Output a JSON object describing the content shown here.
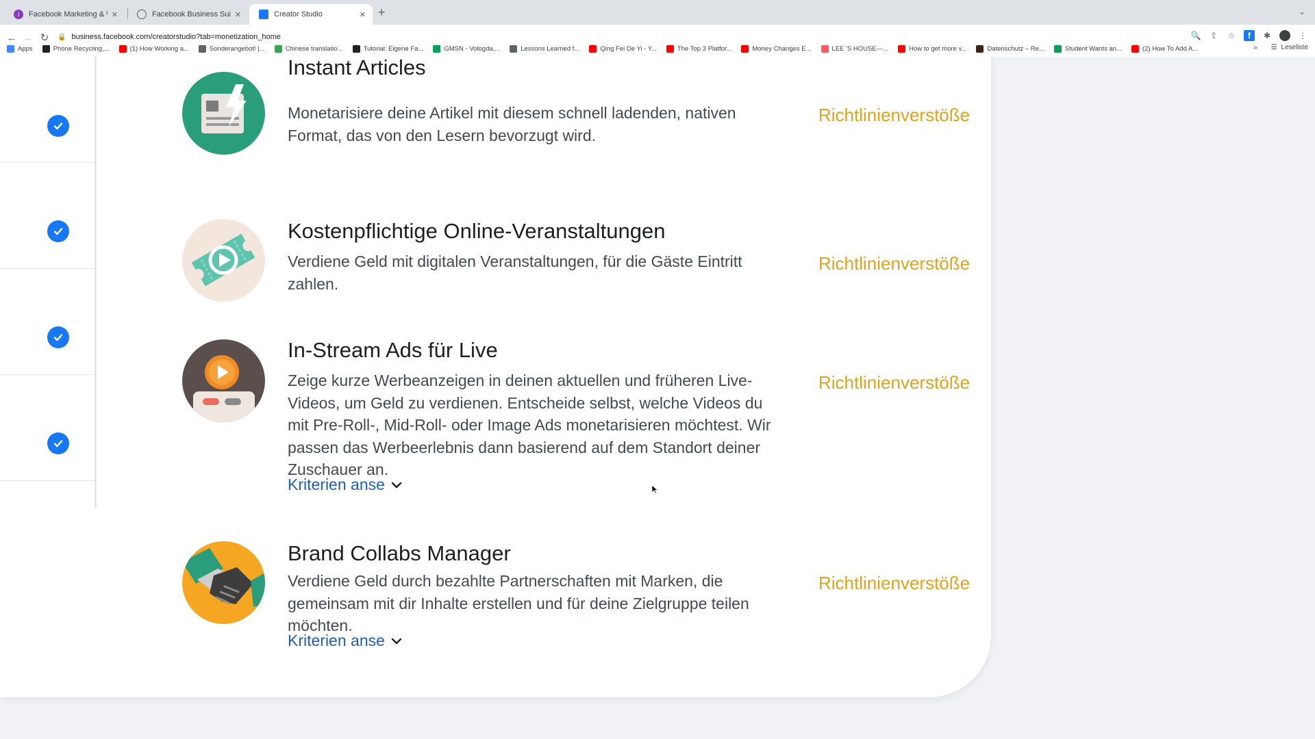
{
  "browser": {
    "tabs": [
      {
        "title": "Facebook Marketing & Werbea",
        "icon": "facebook-marketing-icon",
        "active": false
      },
      {
        "title": "Facebook Business Suite",
        "icon": "business-suite-icon",
        "active": false
      },
      {
        "title": "Creator Studio",
        "icon": "creator-studio-icon",
        "active": true
      }
    ],
    "url": "business.facebook.com/creatorstudio?tab=monetization_home",
    "bookmarks": [
      {
        "label": "Apps",
        "color": "#4285f4"
      },
      {
        "label": "Phone Recycling,...",
        "color": "#202124"
      },
      {
        "label": "(1) How Working a...",
        "color": "#ff0000"
      },
      {
        "label": "Sonderangebot! |...",
        "color": "#5f6368"
      },
      {
        "label": "Chinese translatio...",
        "color": "#34a853"
      },
      {
        "label": "Tutorial: Eigene Fa...",
        "color": "#202124"
      },
      {
        "label": "GMSN - Vologda,...",
        "color": "#0f9d58"
      },
      {
        "label": "Lessons Learned f...",
        "color": "#5f6368"
      },
      {
        "label": "Qing Fei De Yi - Y...",
        "color": "#ff0000"
      },
      {
        "label": "The Top 3 Platfor...",
        "color": "#ff0000"
      },
      {
        "label": "Money Changes E...",
        "color": "#ff0000"
      },
      {
        "label": "LEE 'S HOUSE—...",
        "color": "#ff5a5f"
      },
      {
        "label": "How to get more v...",
        "color": "#ff0000"
      },
      {
        "label": "Datenschutz – Re...",
        "color": "#3c2415"
      },
      {
        "label": "Student Wants an...",
        "color": "#0f9d58"
      },
      {
        "label": "(2) How To Add A...",
        "color": "#ff0000"
      }
    ],
    "reading_list": "Leseliste"
  },
  "monetization": {
    "items": [
      {
        "title": "Instant Articles",
        "description": "Monetarisiere deine Artikel mit diesem schnell ladenden, nativen Format, das von den Lesern bevorzugt wird.",
        "status": "Richtlinienverstöße",
        "icon": "instant-articles-icon"
      },
      {
        "title": "Kostenpflichtige Online-Veranstaltungen",
        "description": "Verdiene Geld mit digitalen Veranstaltungen, für die Gäste Eintritt zahlen.",
        "status": "Richtlinienverstöße",
        "icon": "ticket-icon"
      },
      {
        "title": "In-Stream Ads für Live",
        "description": "Zeige kurze Werbeanzeigen in deinen aktuellen und früheren Live-Videos, um Geld zu verdienen. Entscheide selbst, welche Videos du mit Pre-Roll-, Mid-Roll- oder Image Ads monetarisieren möchtest. Wir passen das Werbeerlebnis dann basierend auf dem Standort deiner Zuschauer an.",
        "status": "Richtlinienverstöße",
        "criteria": "Kriterien anse",
        "icon": "live-ads-icon"
      },
      {
        "title": "Brand Collabs Manager",
        "description": "Verdiene Geld durch bezahlte Partnerschaften mit Marken, die gemeinsam mit dir Inhalte erstellen und für deine Zielgruppe teilen möchten.",
        "status": "Richtlinienverstöße",
        "criteria": "Kriterien anse",
        "icon": "handshake-icon"
      }
    ]
  },
  "colors": {
    "status": "#e4a11b",
    "link": "#1f5fb0",
    "check": "#1877f2"
  }
}
